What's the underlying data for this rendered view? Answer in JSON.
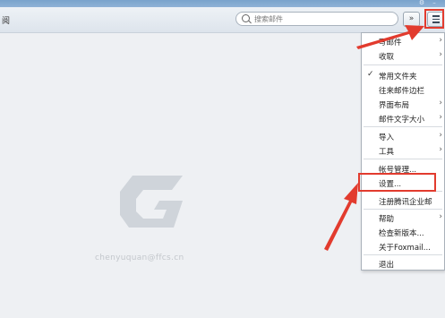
{
  "toolbar": {
    "left_label": "阅",
    "search_placeholder": "搜索邮件",
    "dropdown_icon": "double-chevron-down-icon",
    "menu_icon": "menu-list-icon"
  },
  "menu": {
    "items": [
      {
        "label": "写邮件",
        "submenu": true
      },
      {
        "label": "收取",
        "submenu": true
      },
      {
        "label": "常用文件夹",
        "checked": true
      },
      {
        "label": "往来邮件边栏"
      },
      {
        "label": "界面布局",
        "submenu": true
      },
      {
        "label": "邮件文字大小",
        "submenu": true
      },
      {
        "label": "导入",
        "submenu": true
      },
      {
        "label": "工具",
        "submenu": true
      },
      {
        "label": "帐号管理..."
      },
      {
        "label": "设置..."
      },
      {
        "label": "注册腾讯企业邮"
      },
      {
        "label": "帮助",
        "submenu": true
      },
      {
        "label": "检查新版本..."
      },
      {
        "label": "关于Foxmail..."
      },
      {
        "label": "退出"
      }
    ]
  },
  "watermark": {
    "text": "chenyuquan@ffcs.cn",
    "logo_icon": "foxmail-g-logo-icon"
  },
  "colors": {
    "annotation_red": "#e23b2e",
    "background": "#eef0f3",
    "titlebar": "#7aa3cc"
  }
}
